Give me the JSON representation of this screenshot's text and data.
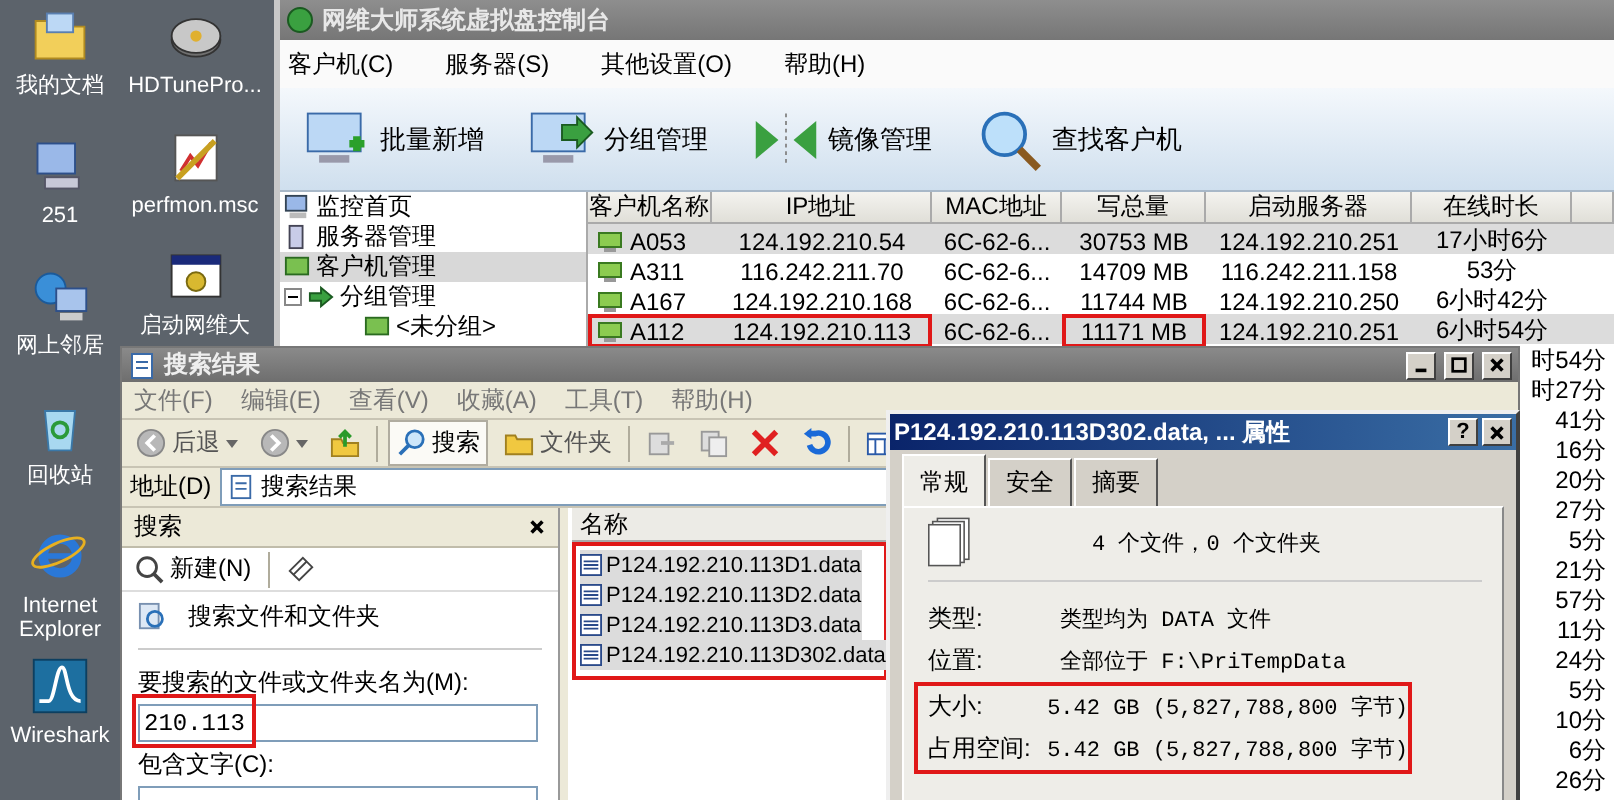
{
  "desktop": {
    "columns": [
      [
        {
          "label": "我的文档",
          "kind": "documents"
        },
        {
          "label": "251",
          "kind": "computer"
        },
        {
          "label": "网上邻居",
          "kind": "network"
        },
        {
          "label": "回收站",
          "kind": "recycle"
        },
        {
          "label": "Internet Explorer",
          "kind": "browser"
        },
        {
          "label": "Wireshark",
          "kind": "wireshark"
        }
      ],
      [
        {
          "label": "HDTunePro...",
          "kind": "disk"
        },
        {
          "label": "perfmon.msc",
          "kind": "perfmon"
        },
        {
          "label": "启动网维大",
          "kind": "app"
        }
      ]
    ]
  },
  "main_window": {
    "title": "网维大师系统虚拟盘控制台",
    "menu": [
      "客户机(C)",
      "服务器(S)",
      "其他设置(O)",
      "帮助(H)"
    ],
    "toolbar": [
      {
        "label": "批量新增",
        "kind": "add"
      },
      {
        "label": "分组管理",
        "kind": "group"
      },
      {
        "label": "镜像管理",
        "kind": "mirror"
      },
      {
        "label": "查找客户机",
        "kind": "find"
      }
    ],
    "tree": [
      {
        "label": "监控首页",
        "kind": "monitor",
        "selected": false
      },
      {
        "label": "服务器管理",
        "kind": "server",
        "selected": false
      },
      {
        "label": "客户机管理",
        "kind": "client",
        "selected": true
      },
      {
        "label": "分组管理",
        "kind": "group",
        "selected": false,
        "expanded": true,
        "children": [
          {
            "label": "<未分组>",
            "kind": "client",
            "selected": false
          }
        ]
      }
    ],
    "table": {
      "columns": [
        "客户机名称",
        "IP地址",
        "MAC地址",
        "写总量",
        "启动服务器",
        "在线时长"
      ],
      "rows": [
        {
          "name": "A053",
          "ip": "124.192.210.54",
          "mac": "6C-62-6...",
          "written": "30753 MB",
          "server": "124.192.210.251",
          "online": "17小时6分",
          "selected": true,
          "boxed": false
        },
        {
          "name": "A311",
          "ip": "116.242.211.70",
          "mac": "6C-62-6...",
          "written": "14709 MB",
          "server": "116.242.211.158",
          "online": "53分",
          "selected": false,
          "boxed": false
        },
        {
          "name": "A167",
          "ip": "124.192.210.168",
          "mac": "6C-62-6...",
          "written": "11744 MB",
          "server": "124.192.210.250",
          "online": "6小时42分",
          "selected": false,
          "boxed": false
        },
        {
          "name": "A112",
          "ip": "124.192.210.113",
          "mac": "6C-62-6...",
          "written": "11171 MB",
          "server": "124.192.210.251",
          "online": "6小时54分",
          "selected": true,
          "boxed": true
        }
      ],
      "partial_rows": [
        {
          "online": "时54分"
        },
        {
          "online": "时27分"
        },
        {
          "online": "41分"
        },
        {
          "online": "16分"
        },
        {
          "online": "20分"
        },
        {
          "online": "27分"
        },
        {
          "online": "5分"
        },
        {
          "online": "21分"
        },
        {
          "online": "57分"
        },
        {
          "online": "11分"
        },
        {
          "online": "24分"
        },
        {
          "online": "5分"
        },
        {
          "online": "10分"
        },
        {
          "online": "6分"
        },
        {
          "online": "26分"
        }
      ]
    }
  },
  "search_window": {
    "title": "搜索结果",
    "menu": [
      "文件(F)",
      "编辑(E)",
      "查看(V)",
      "收藏(A)",
      "工具(T)",
      "帮助(H)"
    ],
    "nav": [
      {
        "kind": "back",
        "label": "后退"
      },
      {
        "kind": "forward"
      },
      {
        "kind": "up"
      }
    ],
    "toggles": [
      {
        "kind": "search",
        "label": "搜索",
        "selected": true
      },
      {
        "kind": "folders",
        "label": "文件夹",
        "selected": false
      }
    ],
    "actions": [
      {
        "kind": "move"
      },
      {
        "kind": "copy"
      },
      {
        "kind": "delete"
      },
      {
        "kind": "undo"
      },
      {
        "kind": "views"
      }
    ],
    "address": {
      "label": "地址(D)",
      "value": "搜索结果"
    },
    "search_pane": {
      "title": "搜索",
      "new_label": "新建(N)",
      "heading": "搜索文件和文件夹",
      "name_label": "要搜索的文件或文件夹名为(M):",
      "name_value": "210.113",
      "name_boxed": true,
      "text_label": "包含文字(C):"
    },
    "results": {
      "column": "名称",
      "boxed": true,
      "files": [
        {
          "name": "P124.192.210.113D1.data",
          "selected": true
        },
        {
          "name": "P124.192.210.113D2.data",
          "selected": true
        },
        {
          "name": "P124.192.210.113D3.data",
          "selected": true
        },
        {
          "name": "P124.192.210.113D302.data",
          "selected": true
        }
      ]
    }
  },
  "properties": {
    "title": "P124.192.210.113D302.data, ... 属性",
    "help_button": "?",
    "tabs": [
      {
        "label": "常规",
        "selected": true
      },
      {
        "label": "安全",
        "selected": false
      },
      {
        "label": "摘要",
        "selected": false
      }
    ],
    "summary": "4 个文件，0 个文件夹",
    "details": [
      {
        "label": "类型:",
        "value": "类型均为 DATA 文件"
      },
      {
        "label": "位置:",
        "value": "全部位于 F:\\PriTempData"
      }
    ],
    "size": {
      "boxed": true,
      "rows": [
        {
          "label": "大小:",
          "value": "5.42 GB (5,827,788,800 字节)"
        },
        {
          "label": "占用空间:",
          "value": "5.42 GB (5,827,788,800 字节)"
        }
      ]
    }
  }
}
